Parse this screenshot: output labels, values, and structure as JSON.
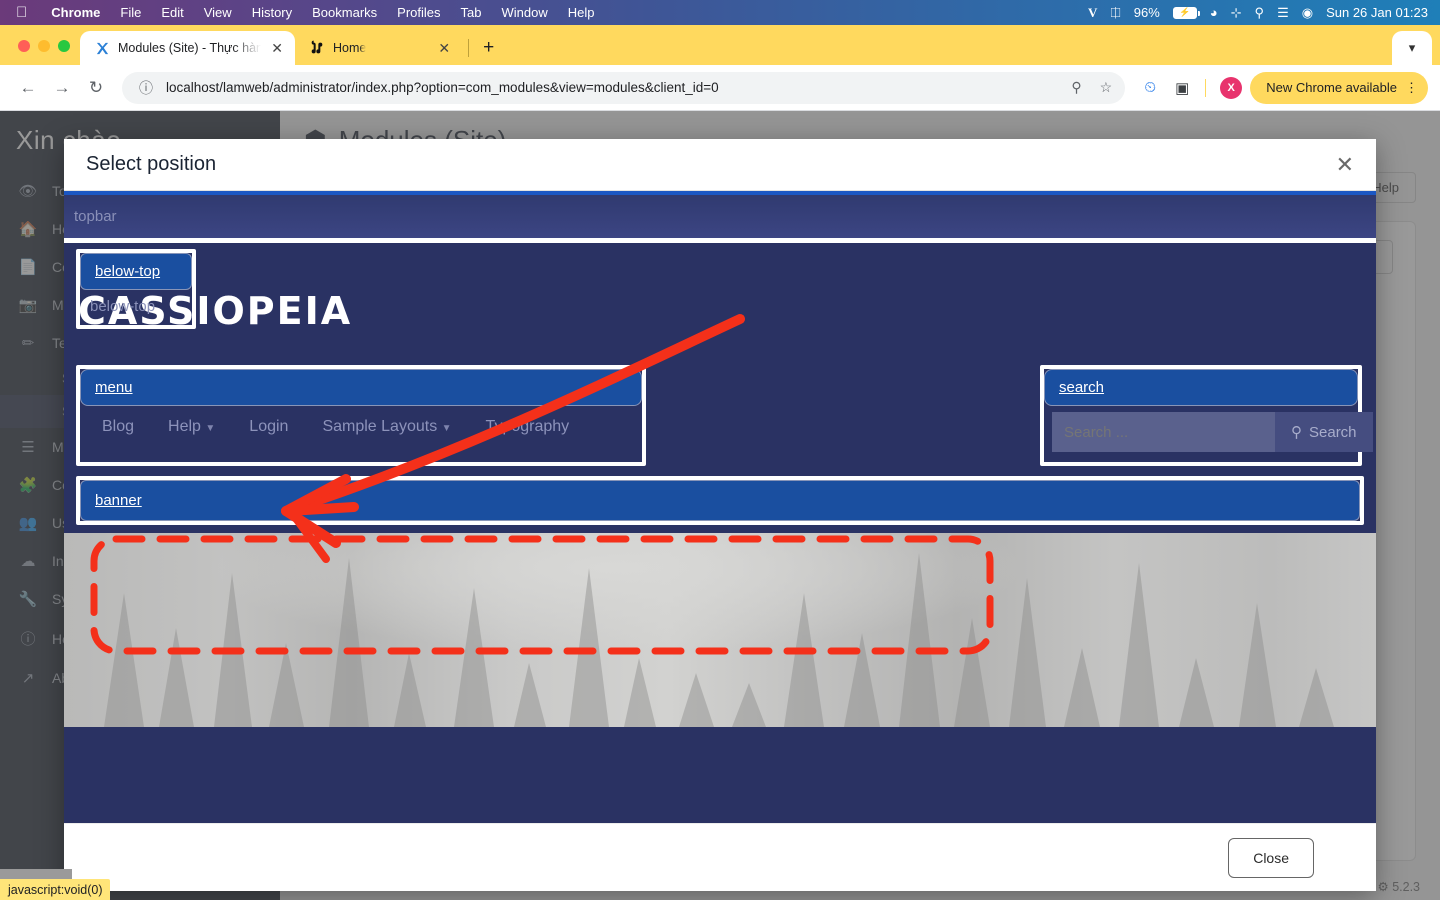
{
  "macos_menubar": {
    "apple_icon": "apple-icon",
    "items": [
      "Chrome",
      "File",
      "Edit",
      "View",
      "History",
      "Bookmarks",
      "Profiles",
      "Tab",
      "Window",
      "Help"
    ],
    "status_icons": [
      "vpn-v-icon",
      "input-source-icon",
      "wifi-icon",
      "bluetooth-off-icon",
      "spotlight-search-icon",
      "control-center-icon",
      "user-avatar-icon"
    ],
    "battery_percent": "96%",
    "battery_icon": "battery-charging-icon",
    "datetime": "Sun 26 Jan  01:23"
  },
  "browser": {
    "tabs": [
      {
        "favicon": "joomla-x-icon",
        "title": "Modules (Site) - Thực hành J",
        "close_icon": "close-icon",
        "active": true
      },
      {
        "favicon": "joomla-icon",
        "title": "Home",
        "close_icon": "close-icon",
        "active": false
      }
    ],
    "new_tab_icon": "plus-icon",
    "tab_list_icon": "chevron-down-icon",
    "back_icon": "arrow-left-icon",
    "forward_icon": "arrow-right-icon",
    "reload_icon": "reload-icon",
    "site_info_icon": "info-circle-icon",
    "url": "localhost/lamweb/administrator/index.php?option=com_modules&view=modules&client_id=0",
    "password_icon": "key-icon",
    "bookmark_icon": "star-icon",
    "extension_icons": [
      "chart-search-icon",
      "extensions-puzzle-icon"
    ],
    "profile_initial": "X",
    "update_label": "New Chrome available",
    "menu_icon": "three-dot-menu-icon"
  },
  "admin": {
    "brand": "Xin chào",
    "sidebar": [
      {
        "icon": "toggle-icon",
        "label": "Toggle Menu"
      },
      {
        "icon": "home-icon",
        "label": "Home Dashboard"
      },
      {
        "icon": "content-icon",
        "label": "Content"
      },
      {
        "icon": "media-icon",
        "label": "Media"
      },
      {
        "icon": "template-icon",
        "label": "Templates"
      },
      {
        "icon": "menus-icon",
        "label": "Menus"
      },
      {
        "icon": "components-icon",
        "label": "Components"
      },
      {
        "icon": "users-icon",
        "label": "Users"
      },
      {
        "icon": "install-icon",
        "label": "Install"
      },
      {
        "icon": "system-icon",
        "label": "System"
      },
      {
        "icon": "help-icon",
        "label": "Help"
      },
      {
        "icon": "about-icon",
        "label": "About"
      }
    ],
    "sidebar_sub": [
      {
        "label": "Site Templates"
      },
      {
        "label": "Site Template Styles"
      }
    ],
    "page_icon": "cube-icon",
    "page_title": "Modules (Site)",
    "help_button": "Help",
    "select_caret_icon": "chevron-down-icon",
    "version": "5.2.3",
    "version_icon": "joomla-icon"
  },
  "modal": {
    "title": "Select position",
    "close_icon": "close-icon",
    "close_button": "Close"
  },
  "preview": {
    "logo": "CASSIOPEIA",
    "positions": [
      {
        "key": "topbar",
        "button": "topbar",
        "name": "topbar"
      },
      {
        "key": "below-top",
        "button": "below-top",
        "name": "below-top"
      },
      {
        "key": "menu",
        "button": "menu",
        "name": "menu"
      },
      {
        "key": "search",
        "button": "search",
        "name": "search"
      },
      {
        "key": "banner",
        "button": "banner",
        "name": "banner"
      }
    ],
    "nav_links": [
      {
        "label": "Blog",
        "has_caret": false
      },
      {
        "label": "Help",
        "has_caret": true
      },
      {
        "label": "Login",
        "has_caret": false
      },
      {
        "label": "Sample Layouts",
        "has_caret": true
      },
      {
        "label": "Typography",
        "has_caret": false
      }
    ],
    "search_placeholder": "Search ...",
    "search_button": "Search",
    "search_icon": "magnifier-icon"
  },
  "annotations": {
    "color": "#f4301a",
    "arrow": "hand-drawn-arrow-to-menu",
    "highlight_box": "dashed-rect-around-menu-position"
  },
  "statusbar": {
    "text": "javascript:void(0)"
  },
  "colors": {
    "mac_bar": "#3f5596",
    "chrome_yellow": "#ffd95e",
    "preview_bg": "#2a3263",
    "position_button": "#1a4fa0",
    "annotation_red": "#f4301a",
    "sidebar_bg": "#1c2230",
    "status_yellow": "#ffe579"
  }
}
